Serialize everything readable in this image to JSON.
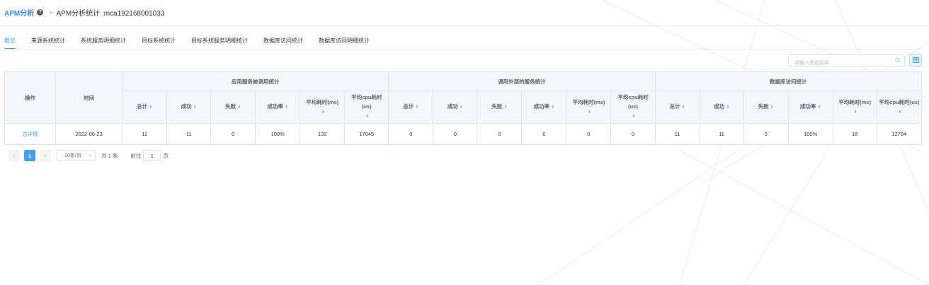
{
  "breadcrumb": {
    "app": "APM分析",
    "page": "APM分析统计 :mca192168001033"
  },
  "tabs": [
    "概览",
    "来源系统统计",
    "系统服务明细统计",
    "目标系统统计",
    "目标系统服务明细统计",
    "数据库访问统计",
    "数据库访问明细统计"
  ],
  "active_tab": 0,
  "search": {
    "placeholder": "请输入筛选条件"
  },
  "table": {
    "col_op": "操作",
    "col_time": "时间",
    "groups": [
      "应用服务被调用统计",
      "调用外部的服务统计",
      "数据库访问统计"
    ],
    "sub_columns": [
      "总计",
      "成功",
      "失败",
      "成功率",
      "平均耗时(ms)",
      "平均cpu耗时(us)"
    ],
    "rows": [
      {
        "action": "总详情",
        "time": "2022-06-23",
        "app": [
          "11",
          "11",
          "0",
          "100%",
          "132",
          "17045"
        ],
        "ext": [
          "0",
          "0",
          "0",
          "0",
          "0",
          "0"
        ],
        "db": [
          "11",
          "11",
          "0",
          "100%",
          "18",
          "12784"
        ]
      }
    ]
  },
  "pagination": {
    "current_page": "1",
    "page_size": "10条/页",
    "total_prefix": "共",
    "total": "1",
    "total_suffix": "条",
    "goto_label": "前往",
    "goto_value": "1",
    "goto_suffix": "页"
  },
  "colors": {
    "accent": "#409eff",
    "brand": "#2d8cf0",
    "header_bg": "#f3f6fa"
  }
}
